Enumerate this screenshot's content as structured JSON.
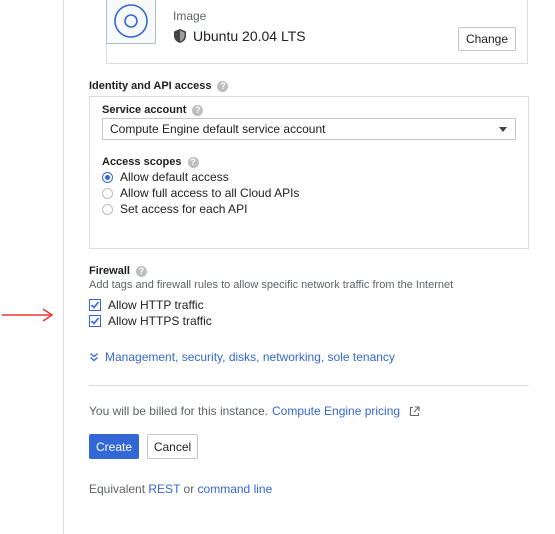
{
  "boot_disk": {
    "image_label": "Image",
    "os_name": "Ubuntu 20.04 LTS",
    "change_label": "Change",
    "disk_icon": "disk-image-icon",
    "shield_icon": "shield-icon"
  },
  "identity": {
    "title": "Identity and API access",
    "service_account_label": "Service account",
    "service_account_value": "Compute Engine default service account",
    "access_scopes_label": "Access scopes",
    "scopes": [
      {
        "label": "Allow default access",
        "selected": true
      },
      {
        "label": "Allow full access to all Cloud APIs",
        "selected": false
      },
      {
        "label": "Set access for each API",
        "selected": false
      }
    ]
  },
  "firewall": {
    "title": "Firewall",
    "description": "Add tags and firewall rules to allow specific network traffic from the Internet",
    "options": [
      {
        "label": "Allow HTTP traffic",
        "checked": true
      },
      {
        "label": "Allow HTTPS traffic",
        "checked": true
      }
    ]
  },
  "management_link": "Management, security, disks, networking, sole tenancy",
  "billing": {
    "text": "You will be billed for this instance.",
    "link": "Compute Engine pricing"
  },
  "actions": {
    "create": "Create",
    "cancel": "Cancel"
  },
  "equivalent": {
    "prefix": "Equivalent",
    "rest": "REST",
    "or": "or",
    "command_line": "command line"
  },
  "colors": {
    "accent": "#3367d6",
    "annotation_arrow": "#e53935"
  }
}
